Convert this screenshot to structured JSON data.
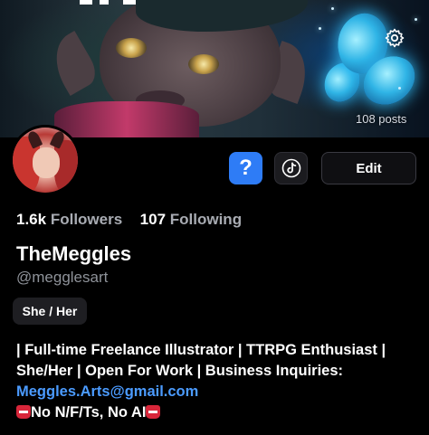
{
  "banner": {
    "post_count": "108 posts",
    "settings_icon": "gear-icon"
  },
  "actions": {
    "help_label": "?",
    "tiktok_icon": "tiktok-icon",
    "edit_label": "Edit"
  },
  "stats": {
    "followers_count": "1.6k",
    "followers_label": "Followers",
    "following_count": "107",
    "following_label": "Following"
  },
  "profile": {
    "display_name": "TheMeggles",
    "handle": "@megglesart",
    "pronouns": "She / Her"
  },
  "bio": {
    "line1": "| Full-time Freelance Illustrator | TTRPG Enthusiast |",
    "line2": "She/Her | Open For Work | Business Inquiries:",
    "email": "Meggles.Arts@gmail.com",
    "line4": "No N/F/Ts, No AI",
    "emoji_icon": "no-entry-emoji-icon"
  },
  "colors": {
    "accent_blue": "#2e7cf6",
    "link_blue": "#4b9bff",
    "background": "#000000",
    "muted_text": "#8e9299"
  }
}
